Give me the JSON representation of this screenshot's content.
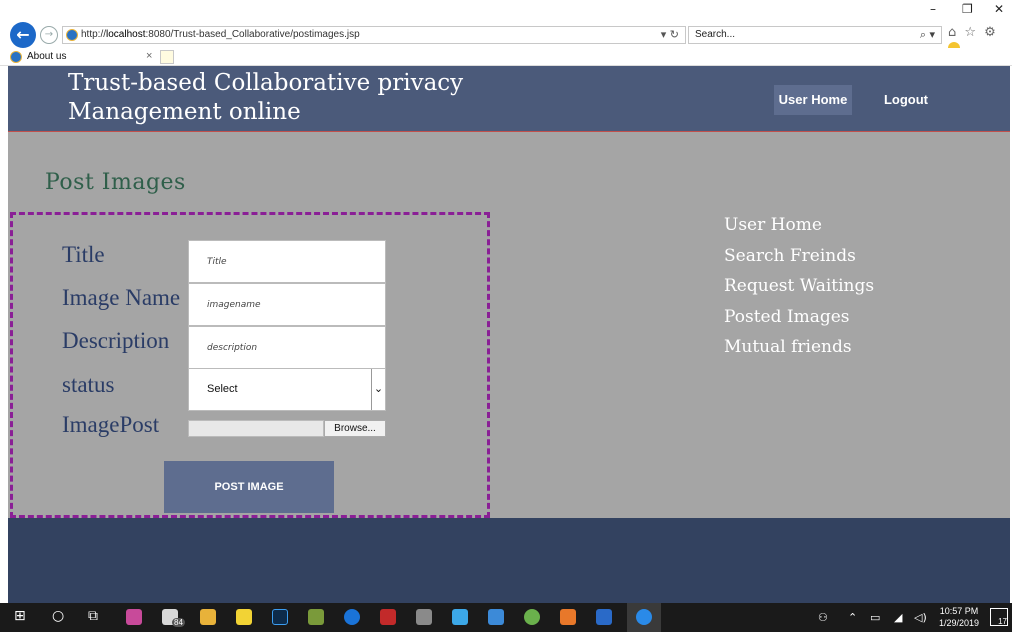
{
  "browser": {
    "url_prefix": "http://",
    "url_host": "localhost",
    "url_rest": ":8080/Trust-based_Collaborative/postimages.jsp",
    "search_placeholder": "Search...",
    "tab_title": "About us",
    "tab_close": "×",
    "back_glyph": "←",
    "forward_glyph": "→",
    "addr_tools": "▾ ↻",
    "search_glyph": "⌕ ▾",
    "tool_glyphs": "⌂ ☆ ⚙",
    "window_controls": {
      "minimize": "–",
      "restore": "❐",
      "close": "✕"
    }
  },
  "header": {
    "site_title": "Trust-based Collaborative privacy Management online",
    "nav": {
      "home": "User Home",
      "logout": "Logout"
    }
  },
  "main": {
    "page_title": "Post Images",
    "form": {
      "labels": {
        "title": "Title",
        "image_name": "Image Name",
        "description": "Description",
        "status": "status",
        "image_post": "ImagePost"
      },
      "placeholders": {
        "title": "Title",
        "image_name": "imagename",
        "description": "description"
      },
      "status_selected": "Select",
      "status_arrow": "⌄",
      "browse_label": "Browse...",
      "submit_label": "POST IMAGE"
    }
  },
  "sidebar": {
    "items": [
      "User Home",
      "Search Freinds",
      "Request Waitings",
      "Posted Images",
      "Mutual friends"
    ]
  },
  "taskbar": {
    "start_glyph": "⊞",
    "search_glyph": "○",
    "taskview_glyph": "⧉",
    "badge_count": "84",
    "clock_time": "10:57 PM",
    "clock_date": "1/29/2019",
    "notification_count": "17"
  },
  "colors": {
    "header_bg": "#4b5a7a",
    "page_bg": "#a5a5a5",
    "footer_bg": "#334260",
    "button_bg": "#5e6d8f",
    "form_border": "#8a1f96",
    "page_title": "#2f5f4a",
    "form_label": "#2a3c66"
  }
}
